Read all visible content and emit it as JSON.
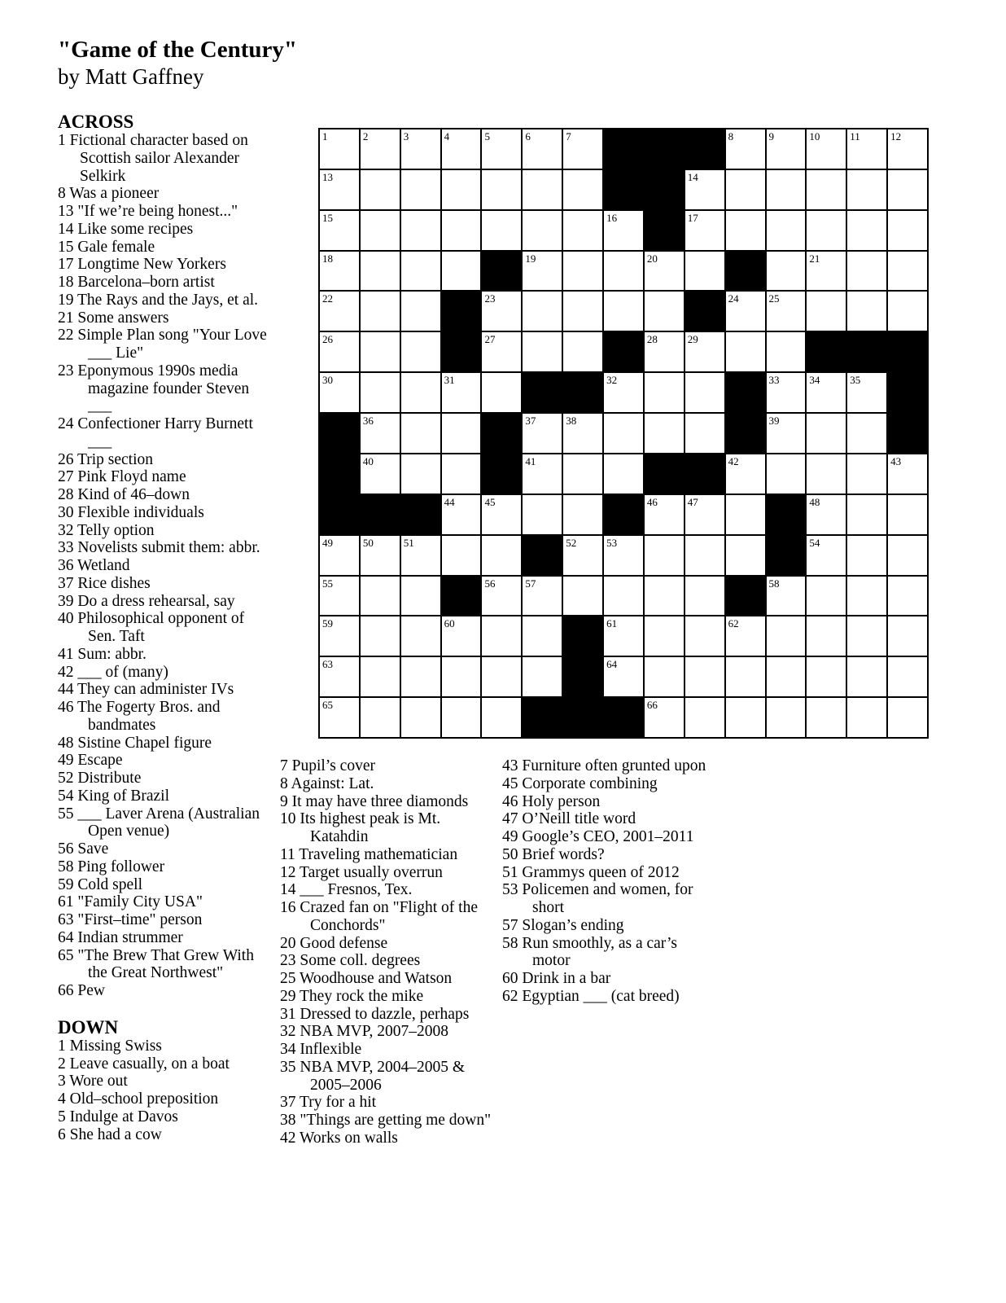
{
  "title": "\"Game of the Century\"",
  "byline": "by Matt Gaffney",
  "across_label": "ACROSS",
  "down_label": "DOWN",
  "grid": {
    "rows": [
      "#######...#####",
      "#######..######",
      "########.######",
      "####.#####.####",
      "###.#####.#####",
      "###.###.####...",
      "#####..###.###.",
      ".###.#####.###.",
      ".###.###..#####",
      "...####.###.###",
      "#####.#####.###",
      "###.######.####",
      "######.########",
      "######.########",
      "#####...#######"
    ],
    "numbers": [
      [
        1,
        2,
        3,
        4,
        5,
        6,
        7,
        0,
        0,
        0,
        8,
        9,
        10,
        11,
        12
      ],
      [
        13,
        0,
        0,
        0,
        0,
        0,
        0,
        0,
        0,
        14,
        0,
        0,
        0,
        0,
        0
      ],
      [
        15,
        0,
        0,
        0,
        0,
        0,
        0,
        16,
        0,
        17,
        0,
        0,
        0,
        0,
        0
      ],
      [
        18,
        0,
        0,
        0,
        0,
        19,
        0,
        0,
        20,
        0,
        0,
        0,
        21,
        0,
        0
      ],
      [
        22,
        0,
        0,
        0,
        23,
        0,
        0,
        0,
        0,
        0,
        24,
        25,
        0,
        0,
        0
      ],
      [
        26,
        0,
        0,
        0,
        27,
        0,
        0,
        0,
        28,
        29,
        0,
        0,
        0,
        0,
        0
      ],
      [
        30,
        0,
        0,
        31,
        0,
        0,
        0,
        32,
        0,
        0,
        0,
        33,
        34,
        35,
        0
      ],
      [
        0,
        36,
        0,
        0,
        0,
        37,
        38,
        0,
        0,
        0,
        0,
        39,
        0,
        0,
        0
      ],
      [
        0,
        40,
        0,
        0,
        0,
        41,
        0,
        0,
        0,
        0,
        42,
        0,
        0,
        0,
        43
      ],
      [
        0,
        0,
        0,
        44,
        45,
        0,
        0,
        0,
        46,
        47,
        0,
        0,
        48,
        0,
        0
      ],
      [
        49,
        50,
        51,
        0,
        0,
        0,
        52,
        53,
        0,
        0,
        0,
        0,
        54,
        0,
        0
      ],
      [
        55,
        0,
        0,
        0,
        56,
        57,
        0,
        0,
        0,
        0,
        0,
        58,
        0,
        0,
        0
      ],
      [
        59,
        0,
        0,
        60,
        0,
        0,
        0,
        61,
        0,
        0,
        62,
        0,
        0,
        0,
        0
      ],
      [
        63,
        0,
        0,
        0,
        0,
        0,
        0,
        64,
        0,
        0,
        0,
        0,
        0,
        0,
        0
      ],
      [
        65,
        0,
        0,
        0,
        0,
        0,
        0,
        0,
        66,
        0,
        0,
        0,
        0,
        0,
        0
      ]
    ]
  },
  "across": [
    "1 Fictional character based on Scottish sailor Alexander Selkirk",
    "8 Was a pioneer",
    "13 \"If we’re being honest...\"",
    "14 Like some recipes",
    "15 Gale female",
    "17 Longtime New Yorkers",
    "18 Barcelona–born artist",
    "19 The Rays and the Jays, et al.",
    "21 Some answers",
    "22 Simple Plan song \"Your Love ___ Lie\"",
    "23 Eponymous 1990s media magazine founder Steven ___",
    "24 Confectioner Harry Burnett ___",
    "26 Trip section",
    "27 Pink Floyd name",
    "28 Kind of 46–down",
    "30 Flexible individuals",
    "32 Telly option",
    "33 Novelists submit them: abbr.",
    "36 Wetland",
    "37 Rice dishes",
    "39 Do a dress rehearsal, say",
    "40 Philosophical opponent of Sen. Taft",
    "41 Sum: abbr.",
    "42 ___ of (many)",
    "44 They can administer IVs",
    "46 The Fogerty Bros. and bandmates",
    "48 Sistine Chapel figure",
    "49 Escape",
    "52 Distribute",
    "54 King of Brazil",
    "55 ___ Laver Arena (Australian Open venue)",
    "56 Save",
    "58 Ping follower",
    "59 Cold spell",
    "61 \"Family City USA\"",
    "63 \"First–time\" person",
    "64 Indian strummer",
    "65 \"The Brew That Grew With the Great Northwest\"",
    "66 Pew"
  ],
  "down_col1": [
    "1 Missing Swiss",
    "2 Leave casually, on a boat",
    "3 Wore out",
    "4 Old–school preposition",
    "5 Indulge at Davos",
    "6 She had a cow"
  ],
  "down_col2": [
    "7 Pupil’s cover",
    "8 Against: Lat.",
    "9 It may have three diamonds",
    "10 Its highest peak is Mt. Katahdin",
    "11 Traveling mathematician",
    "12 Target usually overrun",
    "14 ___ Fresnos, Tex.",
    "16 Crazed fan on \"Flight of the Conchords\"",
    "20 Good defense",
    "23 Some coll. degrees",
    "25 Woodhouse and Watson",
    "29 They rock the mike",
    "31 Dressed to dazzle, perhaps",
    "32 NBA MVP, 2007–2008",
    "34 Inflexible",
    "35 NBA MVP, 2004–2005 & 2005–2006",
    "37 Try for a hit",
    "38 \"Things are getting me down\"",
    "42 Works on walls"
  ],
  "down_col3": [
    "43 Furniture often grunted upon",
    "45 Corporate combining",
    "46 Holy person",
    "47 O’Neill title word",
    "49 Google’s CEO, 2001–2011",
    "50 Brief words?",
    "51 Grammys queen of 2012",
    "53 Policemen and women, for short",
    "57 Slogan’s ending",
    "58 Run smoothly, as a car’s motor",
    "60 Drink in a bar",
    "62 Egyptian ___ (cat breed)"
  ]
}
